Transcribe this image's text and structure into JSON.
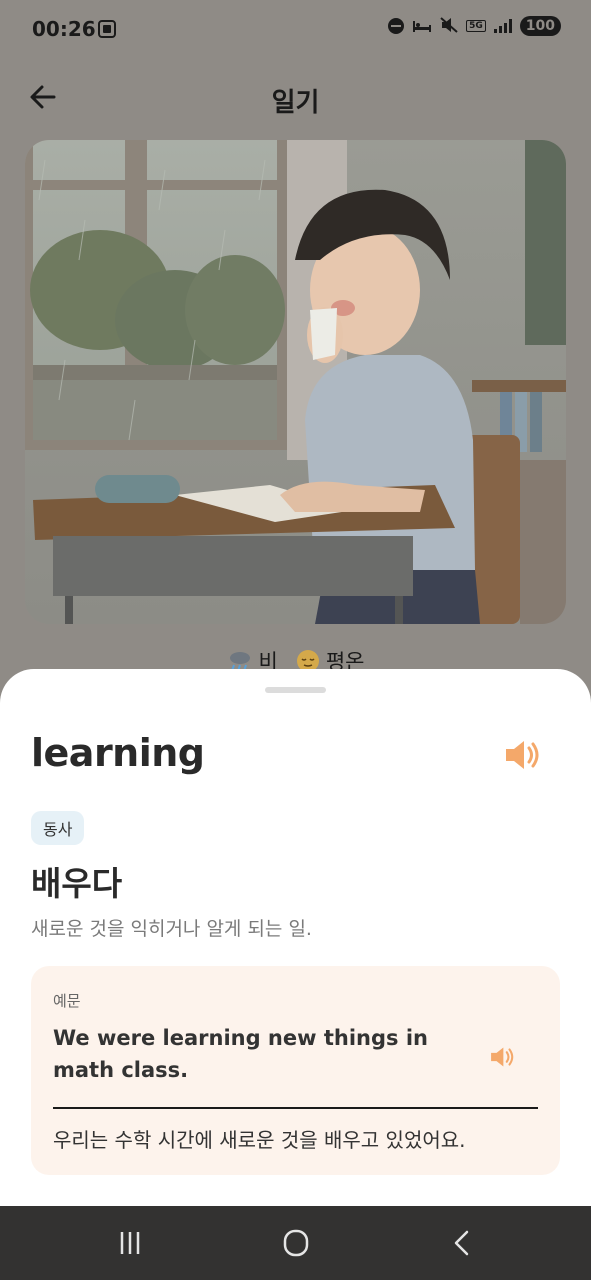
{
  "status_bar": {
    "time": "00:26",
    "network": "5G",
    "battery": "100",
    "icons": [
      "screenshot-icon",
      "dnd-icon",
      "sleep-icon",
      "mute-icon",
      "5g-icon",
      "signal-icon",
      "battery-icon"
    ]
  },
  "header": {
    "title": "일기",
    "back_icon": "arrow-left-icon"
  },
  "diary": {
    "weather": "비",
    "weather_icon": "rain-cloud-icon",
    "mood": "평온",
    "mood_icon": "calm-face-icon"
  },
  "word_card": {
    "word": "learning",
    "part_of_speech": "동사",
    "meaning": "배우다",
    "definition": "새로운 것을 익히거나 알게 되는 일.",
    "example": {
      "label": "예문",
      "english": "We were learning new things in math class.",
      "korean": "우리는 수학 시간에 새로운 것을 배우고 있었어요."
    },
    "accent_color": "#f4a86a"
  },
  "nav_bar": {
    "icons": [
      "recent-apps-icon",
      "home-icon",
      "back-icon"
    ]
  }
}
